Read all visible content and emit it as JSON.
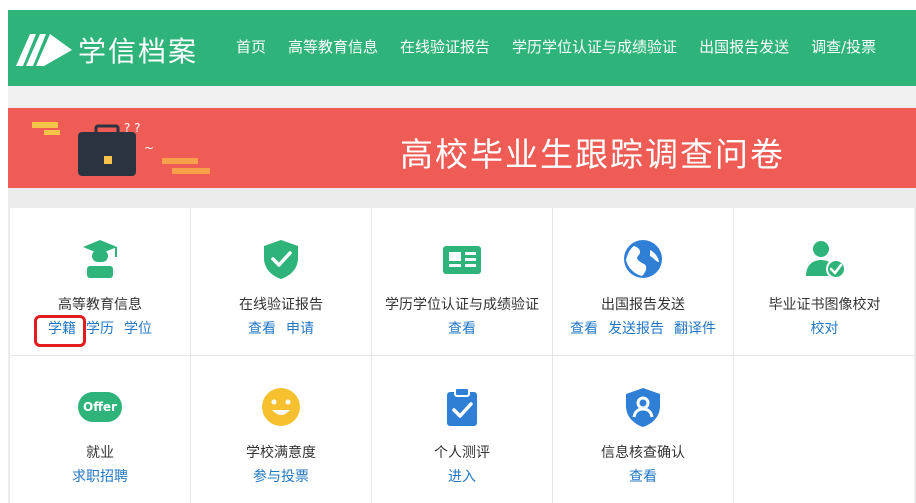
{
  "header": {
    "logo_text": "学信档案",
    "nav": [
      "首页",
      "高等教育信息",
      "在线验证报告",
      "学历学位认证与成绩验证",
      "出国报告发送",
      "调查/投票"
    ]
  },
  "banner": {
    "title": "高校毕业生跟踪调查问卷"
  },
  "cards": [
    {
      "icon": "graduate-icon",
      "title": "高等教育信息",
      "links": [
        "学籍",
        "学历",
        "学位"
      ]
    },
    {
      "icon": "shield-check-icon",
      "title": "在线验证报告",
      "links": [
        "查看",
        "申请"
      ]
    },
    {
      "icon": "id-card-icon",
      "title": "学历学位认证与成绩验证",
      "links": [
        "查看"
      ]
    },
    {
      "icon": "globe-icon",
      "title": "出国报告发送",
      "links": [
        "查看",
        "发送报告",
        "翻译件"
      ]
    },
    {
      "icon": "user-check-icon",
      "title": "毕业证书图像校对",
      "links": [
        "校对"
      ]
    },
    {
      "icon": "offer-icon",
      "title": "就业",
      "links": [
        "求职招聘"
      ],
      "icon_text": "Offer"
    },
    {
      "icon": "smiley-icon",
      "title": "学校满意度",
      "links": [
        "参与投票"
      ]
    },
    {
      "icon": "clipboard-check-icon",
      "title": "个人测评",
      "links": [
        "进入"
      ]
    },
    {
      "icon": "shield-user-icon",
      "title": "信息核查确认",
      "links": [
        "查看"
      ]
    }
  ],
  "colors": {
    "header": "#2eb37a",
    "banner": "#ef5b55",
    "link": "#2378c6",
    "highlight": "#e21d1d"
  }
}
